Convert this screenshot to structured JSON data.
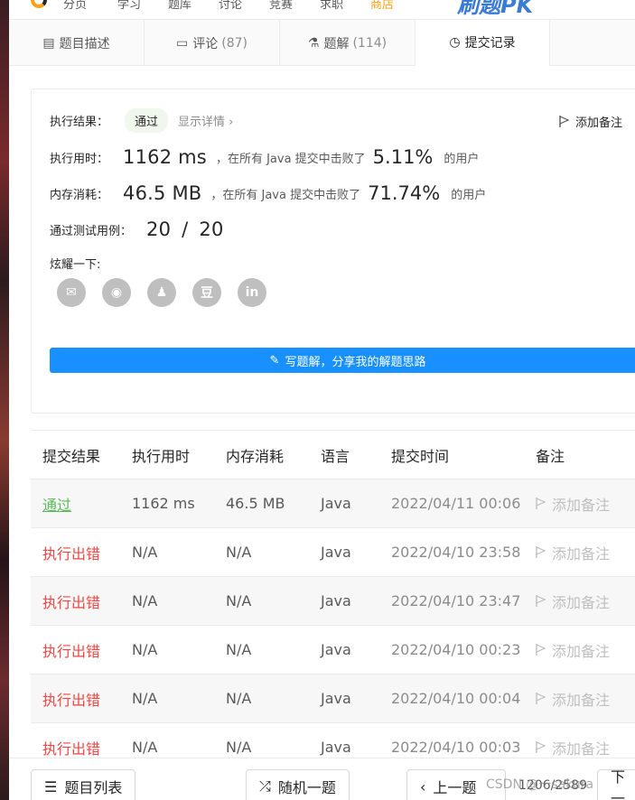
{
  "topnav": {
    "items": [
      "分页",
      "学习",
      "题库",
      "讨论",
      "竞赛",
      "求职",
      "商店"
    ],
    "pk_label": "刷题PK"
  },
  "tabs": [
    {
      "label": "题目描述",
      "count": "",
      "icon": "doc-icon"
    },
    {
      "label": "评论",
      "count": "(87)",
      "icon": "comment-icon"
    },
    {
      "label": "题解",
      "count": "(114)",
      "icon": "flask-icon"
    },
    {
      "label": "提交记录",
      "count": "",
      "icon": "clock-icon"
    }
  ],
  "result": {
    "result_label": "执行结果：",
    "status": "通过",
    "detail_link": "显示详情 ›",
    "add_note": "添加备注",
    "time_label": "执行用时：",
    "time_value": "1162 ms",
    "time_mid": "，在所有 Java 提交中击败了",
    "time_pct": "5.11%",
    "users": "的用户",
    "mem_label": "内存消耗：",
    "mem_value": "46.5 MB",
    "mem_mid": "，在所有 Java 提交中击败了",
    "mem_pct": "71.74%",
    "tests_label": "通过测试用例：",
    "tests_passed": "20",
    "tests_sep": "/",
    "tests_total": "20",
    "share_label": "炫耀一下:",
    "share_icons": [
      "wechat-icon",
      "weibo-icon",
      "qq-icon",
      "douban-icon",
      "linkedin-icon"
    ],
    "share_glyphs": [
      "✉",
      "◉",
      "♟",
      "豆",
      "in"
    ],
    "write_btn": "写题解，分享我的解题思路"
  },
  "table": {
    "headers": [
      "提交结果",
      "执行用时",
      "内存消耗",
      "语言",
      "提交时间",
      "备注"
    ],
    "rows": [
      {
        "status": "通过",
        "ok": true,
        "time": "1162 ms",
        "mem": "46.5 MB",
        "lang": "Java",
        "submitted": "2022/04/11 00:06",
        "note": "添加备注"
      },
      {
        "status": "执行出错",
        "ok": false,
        "time": "N/A",
        "mem": "N/A",
        "lang": "Java",
        "submitted": "2022/04/10 23:58",
        "note": "添加备注"
      },
      {
        "status": "执行出错",
        "ok": false,
        "time": "N/A",
        "mem": "N/A",
        "lang": "Java",
        "submitted": "2022/04/10 23:47",
        "note": "添加备注"
      },
      {
        "status": "执行出错",
        "ok": false,
        "time": "N/A",
        "mem": "N/A",
        "lang": "Java",
        "submitted": "2022/04/10 00:23",
        "note": "添加备注"
      },
      {
        "status": "执行出错",
        "ok": false,
        "time": "N/A",
        "mem": "N/A",
        "lang": "Java",
        "submitted": "2022/04/10 00:04",
        "note": "添加备注"
      },
      {
        "status": "执行出错",
        "ok": false,
        "time": "N/A",
        "mem": "N/A",
        "lang": "Java",
        "submitted": "2022/04/10 00:03",
        "note": "添加备注"
      }
    ]
  },
  "bottombar": {
    "list_btn": "题目列表",
    "random_btn": "随机一题",
    "prev_btn": "上一题",
    "pager": "1206/2589",
    "next_btn": "下一",
    "watermark": "CSDN @一sakura"
  },
  "colors": {
    "pass": "#5cb85c",
    "error": "#ef4743",
    "primary": "#1890ff",
    "brand": "#ffa116"
  }
}
